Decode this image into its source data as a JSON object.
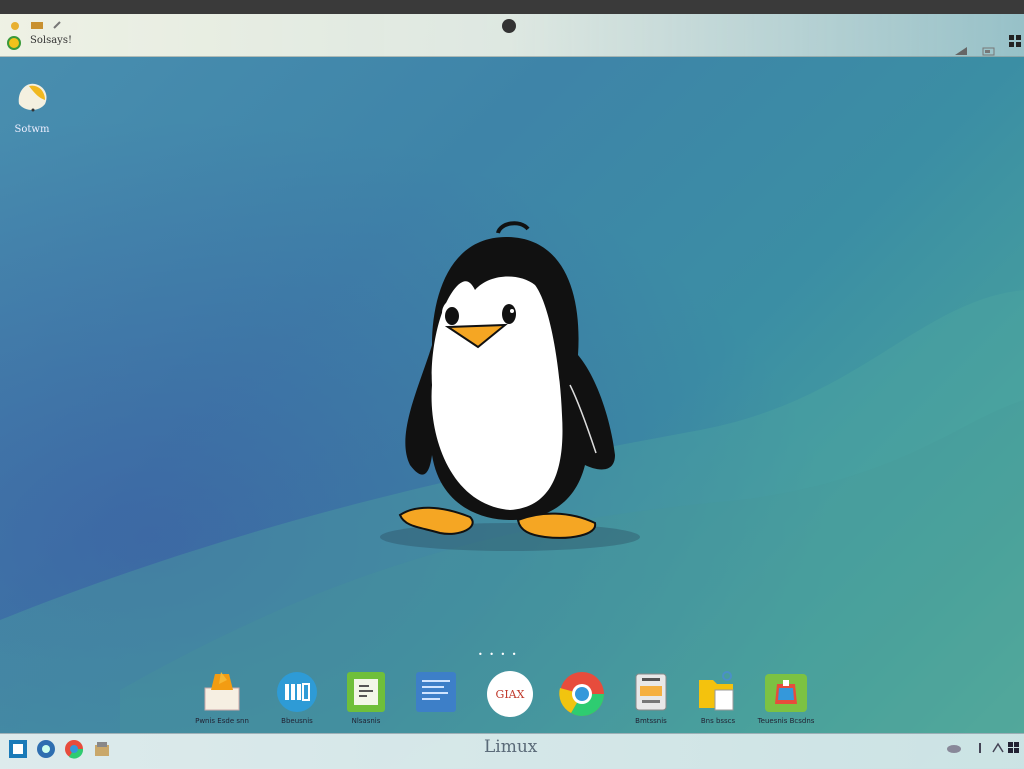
{
  "top_panel": {
    "title": "Solsays!"
  },
  "desktop": {
    "icon_label": "Sotwm"
  },
  "dock": {
    "apps": [
      {
        "name": "files",
        "label": "Pwnis  Esde snn"
      },
      {
        "name": "network",
        "label": "Bbeusnis"
      },
      {
        "name": "editor",
        "label": "Nlsasnis"
      },
      {
        "name": "terminal",
        "label": ""
      },
      {
        "name": "gmail",
        "label": "",
        "icon_text": "GIAX"
      },
      {
        "name": "chrome",
        "label": ""
      },
      {
        "name": "archive",
        "label": "Bmtssnis"
      },
      {
        "name": "folder",
        "label": "Bns bsscs"
      },
      {
        "name": "store",
        "label": "Teuesnis Bcsdns"
      }
    ]
  },
  "taskbar": {
    "center_label": "Limux"
  },
  "colors": {
    "tux_body": "#111111",
    "tux_belly": "#ffffff",
    "tux_beak": "#f5a623"
  }
}
